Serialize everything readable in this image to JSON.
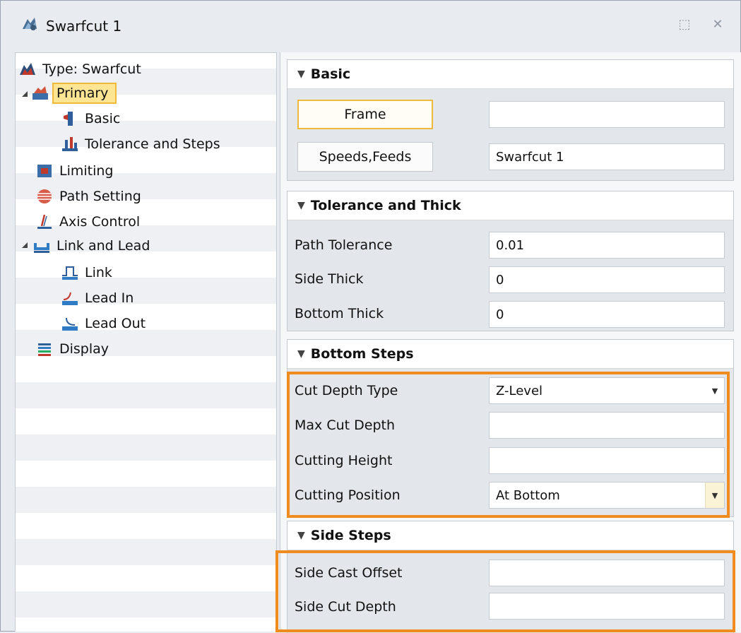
{
  "window": {
    "title": "Swarfcut 1",
    "icon": "swarfcut-icon",
    "buttons": [
      {
        "name": "dock-icon",
        "glyph": "⬚"
      },
      {
        "name": "close-icon",
        "glyph": "✕"
      }
    ]
  },
  "tree": {
    "items": [
      {
        "label": "Type: Swarfcut",
        "icon": "type-icon"
      },
      {
        "label": "Primary",
        "icon": "primary-icon",
        "selected": true,
        "expanded": true
      },
      {
        "label": "Basic",
        "icon": "basic-icon"
      },
      {
        "label": "Tolerance and Steps",
        "icon": "tolerance-icon"
      },
      {
        "label": "Limiting",
        "icon": "limiting-icon"
      },
      {
        "label": "Path Setting",
        "icon": "path-setting-icon"
      },
      {
        "label": "Axis Control",
        "icon": "axis-control-icon"
      },
      {
        "label": "Link and Lead",
        "icon": "link-lead-icon",
        "expanded": true
      },
      {
        "label": "Link",
        "icon": "link-icon"
      },
      {
        "label": "Lead In",
        "icon": "lead-in-icon"
      },
      {
        "label": "Lead Out",
        "icon": "lead-out-icon"
      },
      {
        "label": "Display",
        "icon": "display-icon"
      }
    ]
  },
  "sections": {
    "basic": {
      "title": "Basic",
      "frame_button": "Frame",
      "frame_value": "",
      "speeds_button": "Speeds,Feeds",
      "speeds_value": "Swarfcut 1"
    },
    "tolerance": {
      "title": "Tolerance and Thick",
      "rows": [
        {
          "label": "Path Tolerance",
          "value": "0.01"
        },
        {
          "label": "Side Thick",
          "value": "0"
        },
        {
          "label": "Bottom Thick",
          "value": "0"
        }
      ]
    },
    "bottom_steps": {
      "title": "Bottom Steps",
      "cut_depth_type_label": "Cut Depth Type",
      "cut_depth_type_value": "Z-Level",
      "max_cut_depth_label": "Max Cut Depth",
      "max_cut_depth_value": "",
      "cutting_height_label": "Cutting Height",
      "cutting_height_value": "",
      "cutting_position_label": "Cutting Position",
      "cutting_position_value": "At Bottom"
    },
    "side_steps": {
      "title": "Side Steps",
      "side_cast_offset_label": "Side Cast Offset",
      "side_cast_offset_value": "",
      "side_cut_depth_label": "Side Cut Depth",
      "side_cut_depth_value": ""
    }
  },
  "colors": {
    "highlight": "#f08c1e",
    "selection": "#fde594",
    "selection_border": "#efb93b"
  }
}
